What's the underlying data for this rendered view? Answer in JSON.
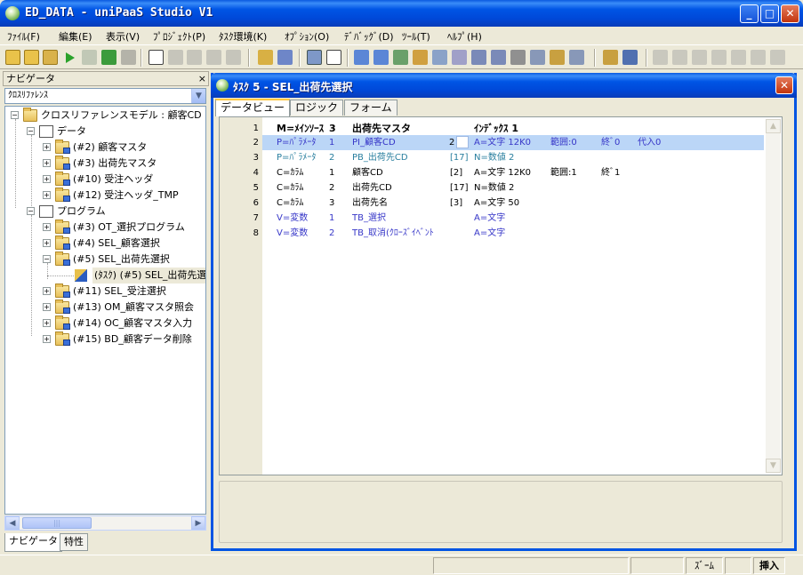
{
  "window": {
    "title": "ED_DATA - uniPaaS Studio V1",
    "btn_min": "_",
    "btn_max": "□",
    "btn_close": "✕"
  },
  "menu": [
    "ﾌｧｲﾙ(F)",
    "編集(E)",
    "表示(V)",
    "ﾌﾟﾛｼﾞｪｸﾄ(P)",
    "ﾀｽｸ環境(K)",
    "ｵﾌﾟｼｮﾝ(O)",
    "ﾃﾞﾊﾞｯｸﾞ(D)",
    "ﾂｰﾙ(T)",
    "ﾍﾙﾌﾟ(H)"
  ],
  "navigator": {
    "header": "ナビゲータ",
    "close": "×",
    "combo_value": "ｸﾛｽﾘﾌｧﾚﾝｽ",
    "tree": [
      {
        "label": "クロスリファレンスモデル : 顧客CD",
        "pm": "−"
      },
      {
        "label": "データ",
        "pm": "−"
      },
      {
        "label": "(#2) 顧客マスタ",
        "pm": "+"
      },
      {
        "label": "(#3) 出荷先マスタ",
        "pm": "+"
      },
      {
        "label": "(#10) 受注ヘッダ",
        "pm": "+"
      },
      {
        "label": "(#12) 受注ヘッダ_TMP",
        "pm": "+"
      },
      {
        "label": "プログラム",
        "pm": "−"
      },
      {
        "label": "(#3) OT_選択プログラム",
        "pm": "+"
      },
      {
        "label": "(#4) SEL_顧客選択",
        "pm": "+"
      },
      {
        "label": "(#5) SEL_出荷先選択",
        "pm": "−"
      },
      {
        "label": "(ﾀｽｸ) (#5) SEL_出荷先選",
        "pm": ""
      },
      {
        "label": "(#11) SEL_受注選択",
        "pm": "+"
      },
      {
        "label": "(#13) OM_顧客マスタ照会",
        "pm": "+"
      },
      {
        "label": "(#14)  OC_顧客マスタ入力",
        "pm": "+"
      },
      {
        "label": "(#15)  BD_顧客データ削除",
        "pm": "+"
      }
    ],
    "tabs": [
      "ナビゲータ",
      "特性"
    ]
  },
  "task": {
    "title": "ﾀｽｸ 5 -   SEL_出荷先選択",
    "close": "✕",
    "tabs": [
      "データビュー",
      "ロジック",
      "フォーム"
    ],
    "rows": [
      {
        "n": "1",
        "a": "M=ﾒｲﾝｿｰｽ",
        "b": "3",
        "c": "出荷先マスタ",
        "d": "",
        "e": "ｲﾝﾃﾞｯｸｽ 1",
        "f": "",
        "g": "",
        "h": ""
      },
      {
        "n": "2",
        "a": "P=ﾊﾟﾗﾒｰﾀ",
        "b": "1",
        "c": "PI_顧客CD",
        "d": "2",
        "e": "A=文字 12K0",
        "f": "範囲:0",
        "g": "終ﾞ0",
        "h": "代入0"
      },
      {
        "n": "3",
        "a": "P=ﾊﾟﾗﾒｰﾀ",
        "b": "2",
        "c": "PB_出荷先CD",
        "d": "[17]",
        "e": "N=数値 2",
        "f": "",
        "g": "",
        "h": ""
      },
      {
        "n": "4",
        "a": "C=ｶﾗﾑ",
        "b": "1",
        "c": "顧客CD",
        "d": "[2]",
        "e": "A=文字 12K0",
        "f": "範囲:1",
        "g": "終ﾞ1",
        "h": ""
      },
      {
        "n": "5",
        "a": "C=ｶﾗﾑ",
        "b": "2",
        "c": "出荷先CD",
        "d": "[17]",
        "e": "N=数値 2",
        "f": "",
        "g": "",
        "h": ""
      },
      {
        "n": "6",
        "a": "C=ｶﾗﾑ",
        "b": "3",
        "c": "出荷先名",
        "d": "[3]",
        "e": "A=文字 50",
        "f": "",
        "g": "",
        "h": ""
      },
      {
        "n": "7",
        "a": "V=変数",
        "b": "1",
        "c": "TB_選択",
        "d": "",
        "e": "A=文字",
        "f": "",
        "g": "",
        "h": ""
      },
      {
        "n": "8",
        "a": "V=変数",
        "b": "2",
        "c": "TB_取消(ｸﾛｰｽﾞｲﾍﾞﾝﾄ",
        "d": "",
        "e": "A=文字",
        "f": "",
        "g": "",
        "h": ""
      }
    ],
    "scroll_up": "▲",
    "scroll_down": "▼"
  },
  "status": {
    "zoom": "ｽﾞｰﾑ",
    "insert": "挿入"
  },
  "colors": {
    "title_blue": "#0055E5",
    "selection": "#BBD6F7",
    "param_blue": "#3737C8",
    "param_teal": "#2A7F9F"
  }
}
